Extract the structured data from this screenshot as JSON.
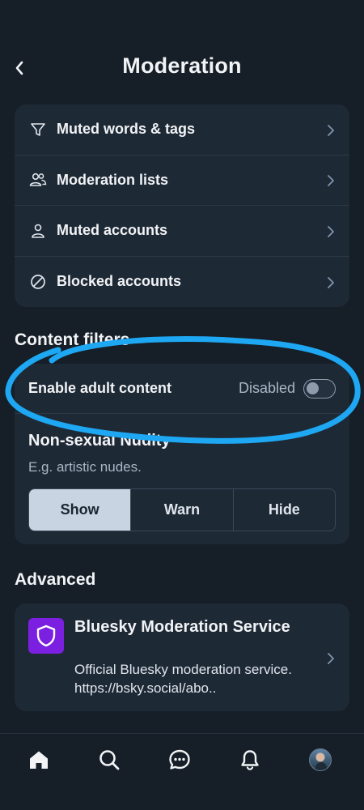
{
  "header": {
    "title": "Moderation"
  },
  "menu": {
    "items": [
      {
        "label": "Muted words & tags",
        "icon": "filter-icon"
      },
      {
        "label": "Moderation lists",
        "icon": "people-icon"
      },
      {
        "label": "Muted accounts",
        "icon": "person-icon"
      },
      {
        "label": "Blocked accounts",
        "icon": "block-icon"
      }
    ]
  },
  "content_filters": {
    "title": "Content filters",
    "adult": {
      "label": "Enable adult content",
      "status": "Disabled",
      "enabled": false
    },
    "nudity": {
      "title": "Non-sexual Nudity",
      "description": "E.g. artistic nudes.",
      "options": [
        "Show",
        "Warn",
        "Hide"
      ],
      "selected": "Show"
    }
  },
  "advanced": {
    "title": "Advanced",
    "service": {
      "name": "Bluesky Moderation Service",
      "description": "Official Bluesky moderation service. https://bsky.social/abo.."
    }
  },
  "tabs": [
    "home-icon",
    "search-icon",
    "chat-icon",
    "bell-icon",
    "profile-avatar"
  ],
  "colors": {
    "background": "#161e27",
    "card": "#1e2936",
    "accent_purple": "#7b1fe0",
    "annotation_blue": "#1ea7f2",
    "active_segment": "#c8d4e1"
  }
}
